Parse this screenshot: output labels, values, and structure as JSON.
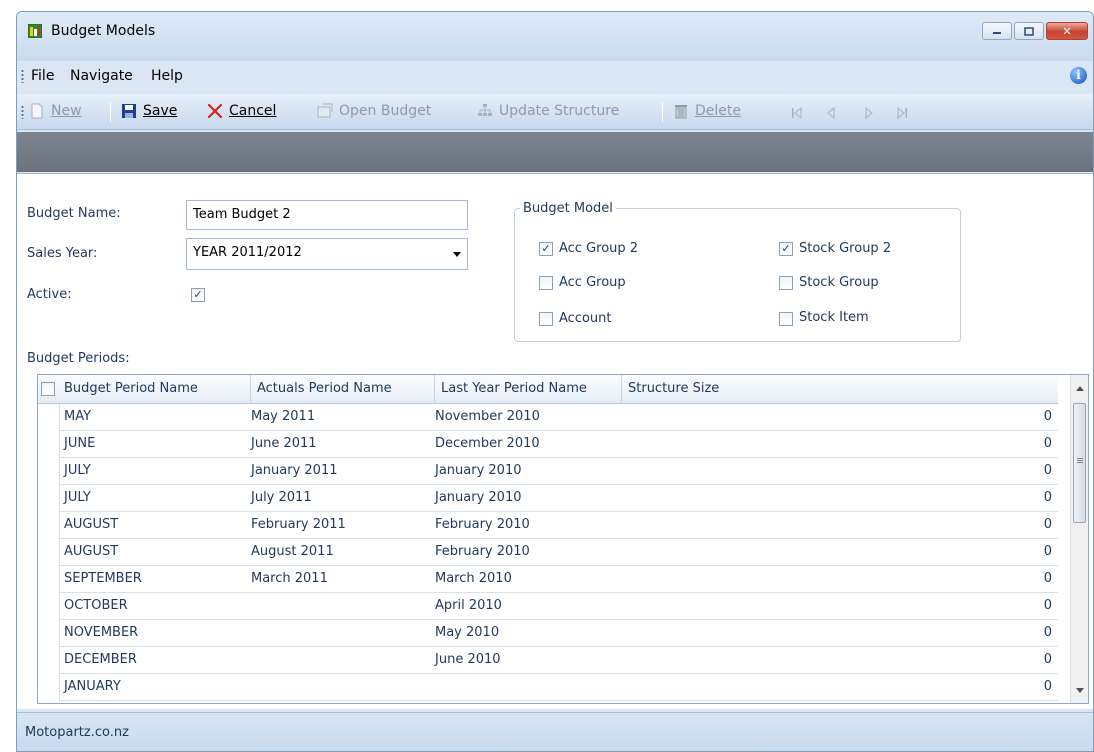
{
  "window": {
    "title": "Budget Models",
    "buttons": {
      "minimize": "▭",
      "maximize": "▭",
      "close": "✕"
    }
  },
  "menu": {
    "items": [
      "File",
      "Navigate",
      "Help"
    ],
    "info_icon_glyph": "i"
  },
  "toolbar": {
    "new_label": "New",
    "save_label": "Save",
    "cancel_label": "Cancel",
    "open_budget_label": "Open Budget",
    "update_structure_label": "Update Structure",
    "delete_label": "Delete"
  },
  "form": {
    "budget_name_label": "Budget Name:",
    "budget_name_value": "Team Budget 2",
    "sales_year_label": "Sales Year:",
    "sales_year_value": "YEAR 2011/2012",
    "active_label": "Active:",
    "active_checked": true
  },
  "budget_model": {
    "title": "Budget Model",
    "options": [
      {
        "label": "Acc Group 2",
        "checked": true
      },
      {
        "label": "Stock Group 2",
        "checked": true
      },
      {
        "label": "Acc Group",
        "checked": false
      },
      {
        "label": "Stock Group",
        "checked": false
      },
      {
        "label": "Account",
        "checked": false
      },
      {
        "label": "Stock Item",
        "checked": false
      }
    ]
  },
  "periods": {
    "label": "Budget Periods:",
    "columns": [
      "Budget Period Name",
      "Actuals Period Name",
      "Last Year Period Name",
      "Structure Size"
    ],
    "rows": [
      [
        "MAY",
        "May 2011",
        "November 2010",
        "0"
      ],
      [
        "JUNE",
        "June 2011",
        "December 2010",
        "0"
      ],
      [
        "JULY",
        "January 2011",
        "January 2010",
        "0"
      ],
      [
        "JULY",
        "July 2011",
        "January 2010",
        "0"
      ],
      [
        "AUGUST",
        "February 2011",
        "February 2010",
        "0"
      ],
      [
        "AUGUST",
        "August 2011",
        "February 2010",
        "0"
      ],
      [
        "SEPTEMBER",
        "March 2011",
        "March 2010",
        "0"
      ],
      [
        "OCTOBER",
        "",
        "April 2010",
        "0"
      ],
      [
        "NOVEMBER",
        "",
        "May 2010",
        "0"
      ],
      [
        "DECEMBER",
        "",
        "June 2010",
        "0"
      ],
      [
        "JANUARY",
        "",
        "",
        "0"
      ]
    ]
  },
  "status": {
    "text": "Motopartz.co.nz"
  },
  "colors": {
    "accent": "#1e395b",
    "close_red": "#c7452f",
    "cancel_red": "#d8231b"
  }
}
